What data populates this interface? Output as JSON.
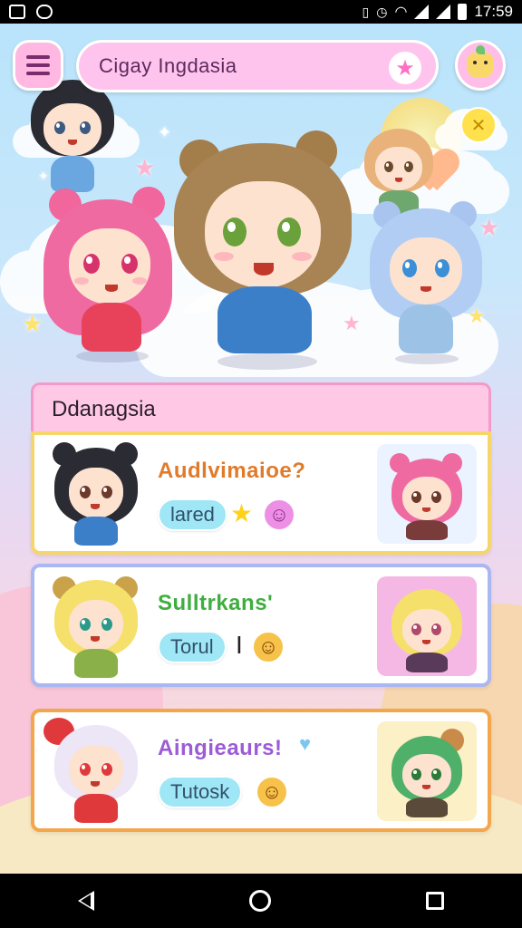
{
  "status_bar": {
    "time": "17:59",
    "left_icons": [
      "gallery-icon",
      "app-notification-icon"
    ],
    "right_icons": [
      "vibrate-icon",
      "alarm-icon",
      "wifi-icon",
      "signal-icon",
      "signal-icon",
      "battery-icon"
    ]
  },
  "header": {
    "title": "Cigay Ingdasia",
    "menu_icon": "hamburger-menu-icon",
    "title_icon": "star-icon",
    "profile_icon": "bunny-avatar-icon"
  },
  "panel": {
    "title": "Ddanagsia"
  },
  "cards": [
    {
      "title": "Audlvimaioe?",
      "title_color": "#e07b2a",
      "tag": "lared",
      "border_color": "#f6d56a",
      "extras": [
        "star-icon",
        "smiley-icon"
      ]
    },
    {
      "title": "Sulltrkans'",
      "title_color": "#3fae3f",
      "tag": "Torul",
      "extra_text": "I",
      "border_color": "#8fa8ef",
      "extras": [
        "smiley-icon"
      ]
    },
    {
      "title": "Aingieaurs!",
      "title_color": "#9b5cd6",
      "tag": "Tutosk",
      "border_color": "#f3a64c",
      "extras": [
        "heart-icon",
        "smiley-icon"
      ]
    }
  ],
  "colors": {
    "title_bar": "#ffc4ee",
    "panel_header": "#ffc9e6",
    "pill": "#9fe7f6"
  },
  "nav_bar": {
    "buttons": [
      "back-icon",
      "home-icon",
      "recent-apps-icon"
    ]
  }
}
